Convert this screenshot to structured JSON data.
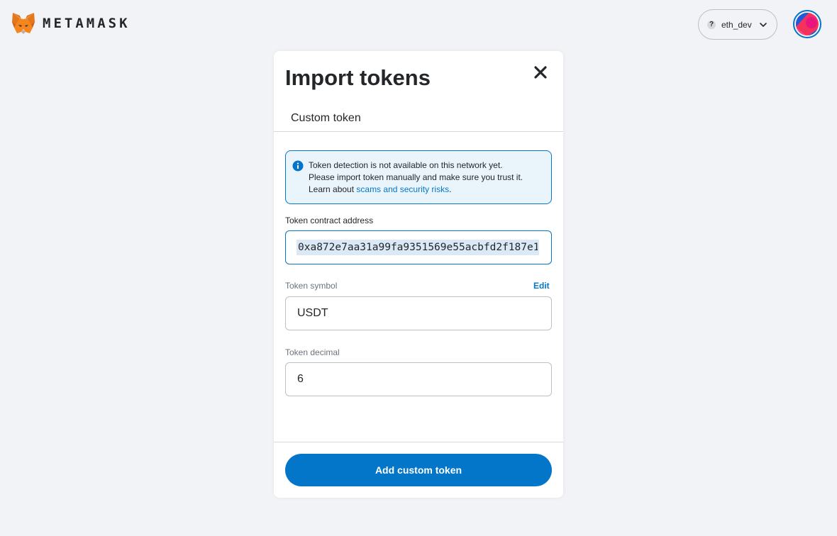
{
  "app": {
    "brand": "METAMASK",
    "network": "eth_dev",
    "network_badge": "?"
  },
  "modal": {
    "title": "Import tokens",
    "tab_label": "Custom token",
    "alert": {
      "line1": "Token detection is not available on this network yet.",
      "line2": "Please import token manually and make sure you trust it.",
      "line3_prefix": "Learn about ",
      "link": "scams and security risks",
      "line3_suffix": "."
    },
    "contract": {
      "label": "Token contract address",
      "value": "0xa872e7aa31a99fa9351569e55acbfd2f187e1"
    },
    "symbol": {
      "label": "Token symbol",
      "edit_label": "Edit",
      "value": "USDT"
    },
    "decimal": {
      "label": "Token decimal",
      "value": "6"
    },
    "submit_label": "Add custom token"
  },
  "icons": {
    "logo": "metamask-fox-icon",
    "close": "close-icon",
    "info": "info-icon",
    "chevron": "chevron-down-icon"
  },
  "colors": {
    "primary": "#0376c9",
    "background": "#f2f3f6",
    "alert_bg": "#eaf4fb",
    "text": "#24272a"
  }
}
